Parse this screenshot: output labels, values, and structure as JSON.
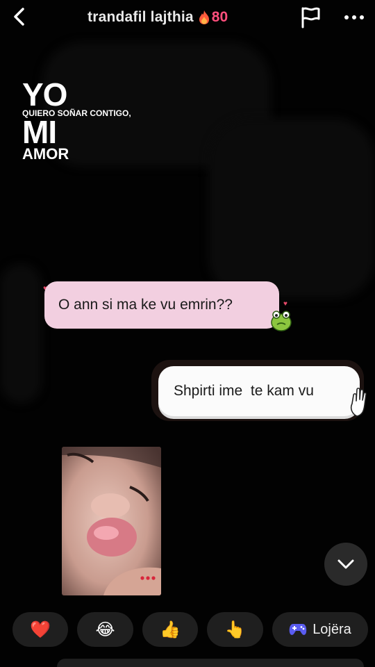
{
  "header": {
    "title": "trandafil lajthia",
    "streak_icon": "flame-icon",
    "streak_count": "80"
  },
  "overlay": {
    "line1": "YO",
    "line2": "QUIERO SOÑAR CONTIGO,",
    "line3": "MI",
    "line4": "AMOR"
  },
  "messages": {
    "incoming": {
      "text": "O ann si ma ke vu emrin??",
      "sticker": "frog-sticker-icon"
    },
    "outgoing": {
      "text": "Shpirti ime  te kam vu",
      "sticker": "hand-sticker-icon"
    }
  },
  "reactions": [
    {
      "name": "heart",
      "glyph": "❤️"
    },
    {
      "name": "laughing",
      "glyph": "😂"
    },
    {
      "name": "thumbs-up",
      "glyph": "👍"
    },
    {
      "name": "pointing",
      "glyph": "👆"
    }
  ],
  "games": {
    "label": "Lojëra",
    "icon": "gamepad-icon"
  },
  "colors": {
    "incoming_bubble": "#f2cfe0",
    "outgoing_bubble": "#fbfbfb",
    "streak": "#ff4f7d",
    "games_icon": "#5a5cf0"
  }
}
